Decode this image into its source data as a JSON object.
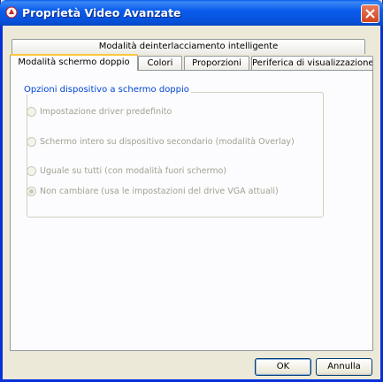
{
  "window": {
    "title": "Proprietà Video Avanzate"
  },
  "tabs": {
    "row_back": [
      "Modalità deinterlacciamento intelligente"
    ],
    "row_front": [
      {
        "label": "Modalità schermo doppio",
        "active": true
      },
      {
        "label": "Colori",
        "active": false
      },
      {
        "label": "Proporzioni",
        "active": false
      },
      {
        "label": "Periferica di visualizzazione",
        "active": false
      }
    ]
  },
  "group": {
    "legend": "Opzioni dispositivo a schermo doppio",
    "options": [
      {
        "label": "Impostazione driver predefinito",
        "checked": false,
        "enabled": false
      },
      {
        "label": "Schermo intero su dispositivo secondario (modalità Overlay)",
        "checked": false,
        "enabled": false
      },
      {
        "label": "Uguale su tutti (con modalità fuori schermo)",
        "checked": false,
        "enabled": false
      },
      {
        "label": "Non cambiare (usa le impostazioni del drive VGA attuali)",
        "checked": true,
        "enabled": false
      }
    ]
  },
  "buttons": {
    "ok": "OK",
    "cancel": "Annulla"
  },
  "colors": {
    "titlebar": "#0a5ded",
    "legend_text": "#0046d5",
    "disabled_text": "#a1a192",
    "active_tab_accent": "#ffc83c"
  }
}
